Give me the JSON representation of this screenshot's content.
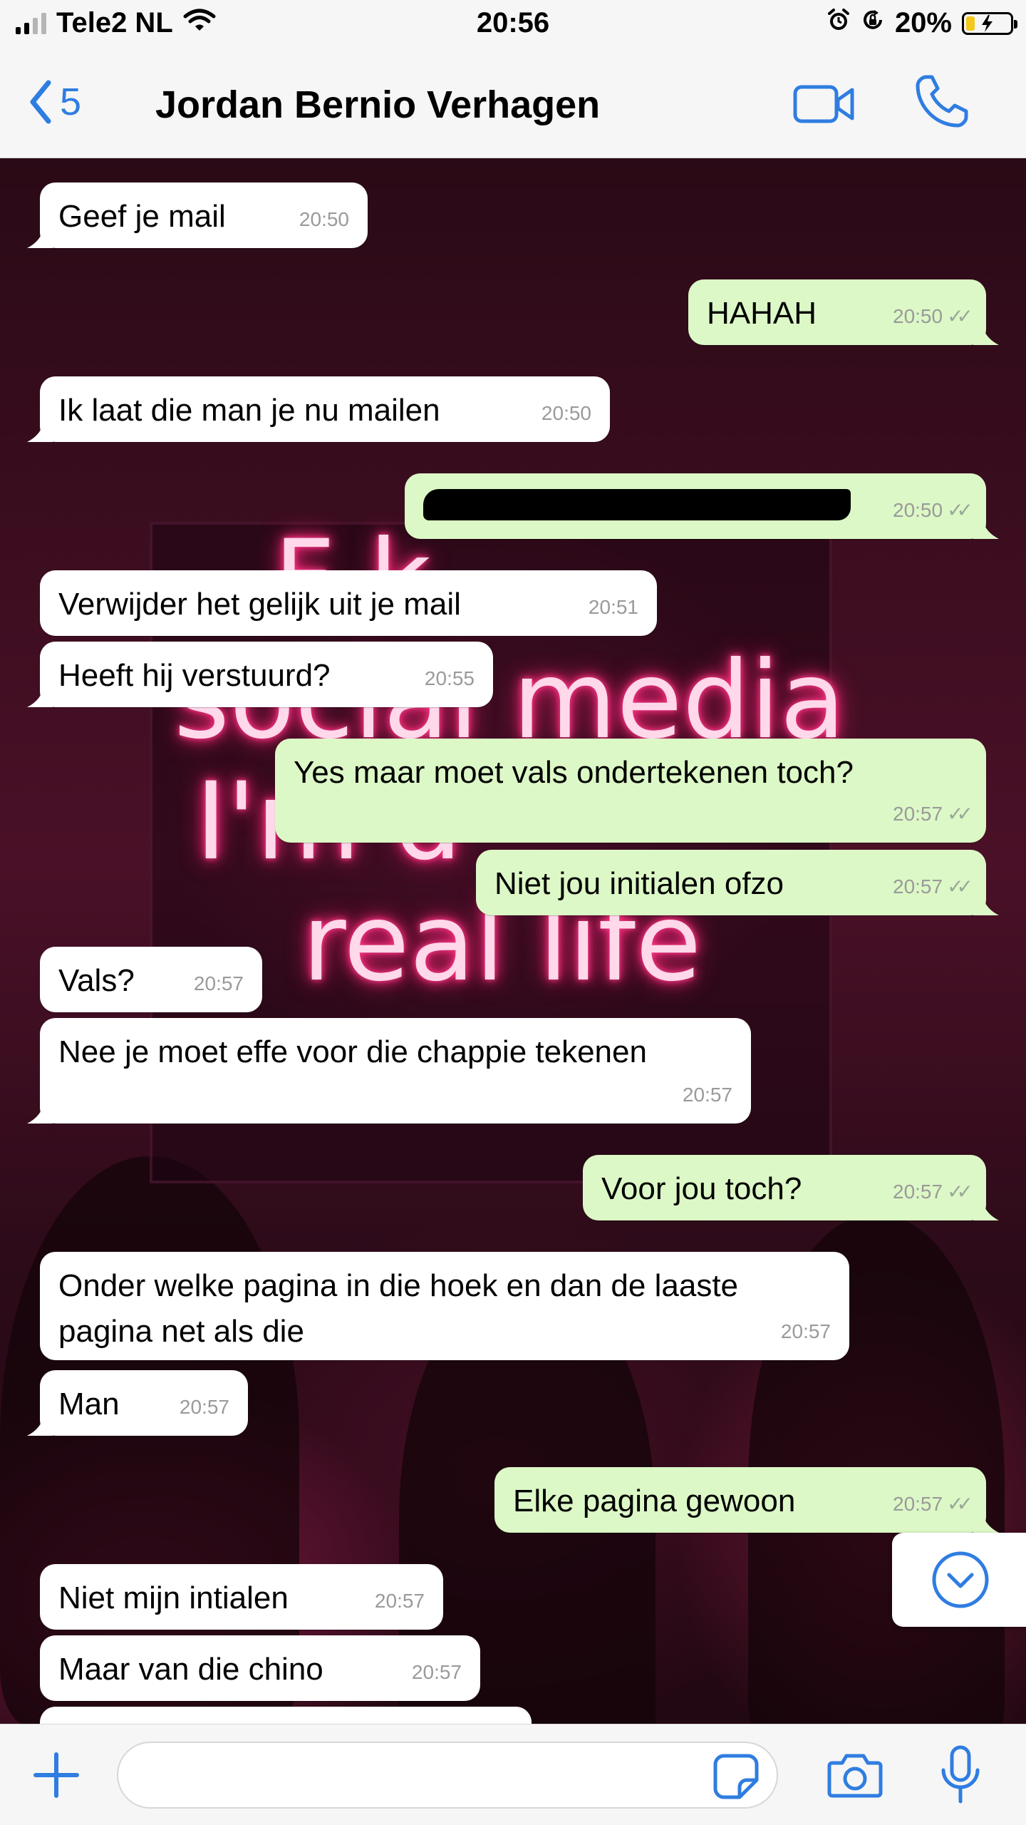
{
  "status_bar": {
    "carrier": "Tele2 NL",
    "time": "20:56",
    "battery": "20%",
    "battery_level": 0.2,
    "signal_bars": 2
  },
  "header": {
    "back_count": "5",
    "contact_name": "Jordan Bernio Verhagen",
    "icons": [
      "chevron-left-icon",
      "video-camera-icon",
      "phone-icon"
    ]
  },
  "wallpaper": {
    "neon_lines": [
      "F    k",
      "social media",
      "I'm d",
      "real life"
    ]
  },
  "messages": [
    {
      "direction": "in",
      "text": "Geef je mail",
      "time": "20:50"
    },
    {
      "direction": "out",
      "text": "HAHAH",
      "time": "20:50"
    },
    {
      "direction": "in",
      "text": "Ik laat die man je nu mailen",
      "time": "20:50"
    },
    {
      "direction": "out",
      "text": "",
      "time": "20:50",
      "redacted": true
    },
    {
      "direction": "in",
      "text": "Verwijder het gelijk uit je mail",
      "time": "20:51"
    },
    {
      "direction": "in",
      "text": "Heeft hij verstuurd?",
      "time": "20:55"
    },
    {
      "direction": "out",
      "text": "Yes maar moet vals ondertekenen toch?",
      "time": "20:57"
    },
    {
      "direction": "out",
      "text": "Niet jou initialen ofzo",
      "time": "20:57"
    },
    {
      "direction": "in",
      "text": "Vals?",
      "time": "20:57"
    },
    {
      "direction": "in",
      "text": "Nee je moet effe voor die chappie tekenen",
      "time": "20:57"
    },
    {
      "direction": "out",
      "text": "Voor jou toch?",
      "time": "20:57"
    },
    {
      "direction": "in",
      "text": "Onder welke pagina in die hoek en dan de laaste",
      "text2": "pagina net als die",
      "time": "20:57"
    },
    {
      "direction": "in",
      "text": "Man",
      "time": "20:57"
    },
    {
      "direction": "out",
      "text": "Elke pagina gewoon",
      "time": "20:57"
    },
    {
      "direction": "in",
      "text": "Niet mijn intialen",
      "time": "20:57"
    },
    {
      "direction": "in",
      "text": "Maar van die chino",
      "time": "20:57"
    }
  ],
  "composer": {
    "input_value": "",
    "icons": [
      "plus-icon",
      "sticker-icon",
      "camera-icon",
      "microphone-icon"
    ]
  },
  "colors": {
    "accent": "#2f7de1",
    "outgoing_bubble": "#dcf8c6",
    "incoming_bubble": "#ffffff"
  }
}
